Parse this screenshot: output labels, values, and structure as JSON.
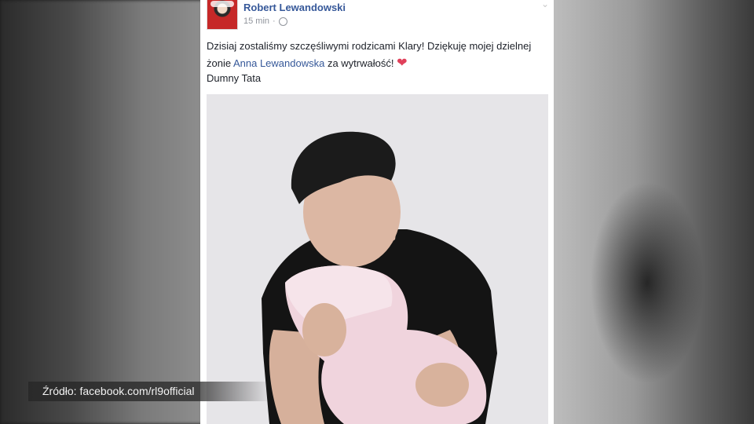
{
  "post": {
    "author": "Robert Lewandowski",
    "time": "15 min",
    "separator": "·",
    "text_before_mention": "Dzisiaj zostaliśmy szczęśliwymi rodzicami Klary! Dziękuję mojej dzielnej żonie ",
    "mention": "Anna Lewandowska",
    "text_after_mention": " za wytrwałość! ",
    "heart": "❤",
    "signature": "Dumny Tata",
    "menu_icon": "chevron-down-icon",
    "privacy_icon": "globe-icon"
  },
  "overlay": {
    "source_caption": "Źródło: facebook.com/rl9official"
  },
  "colors": {
    "link": "#365899",
    "meta": "#90949c",
    "heart": "#e0405a"
  }
}
